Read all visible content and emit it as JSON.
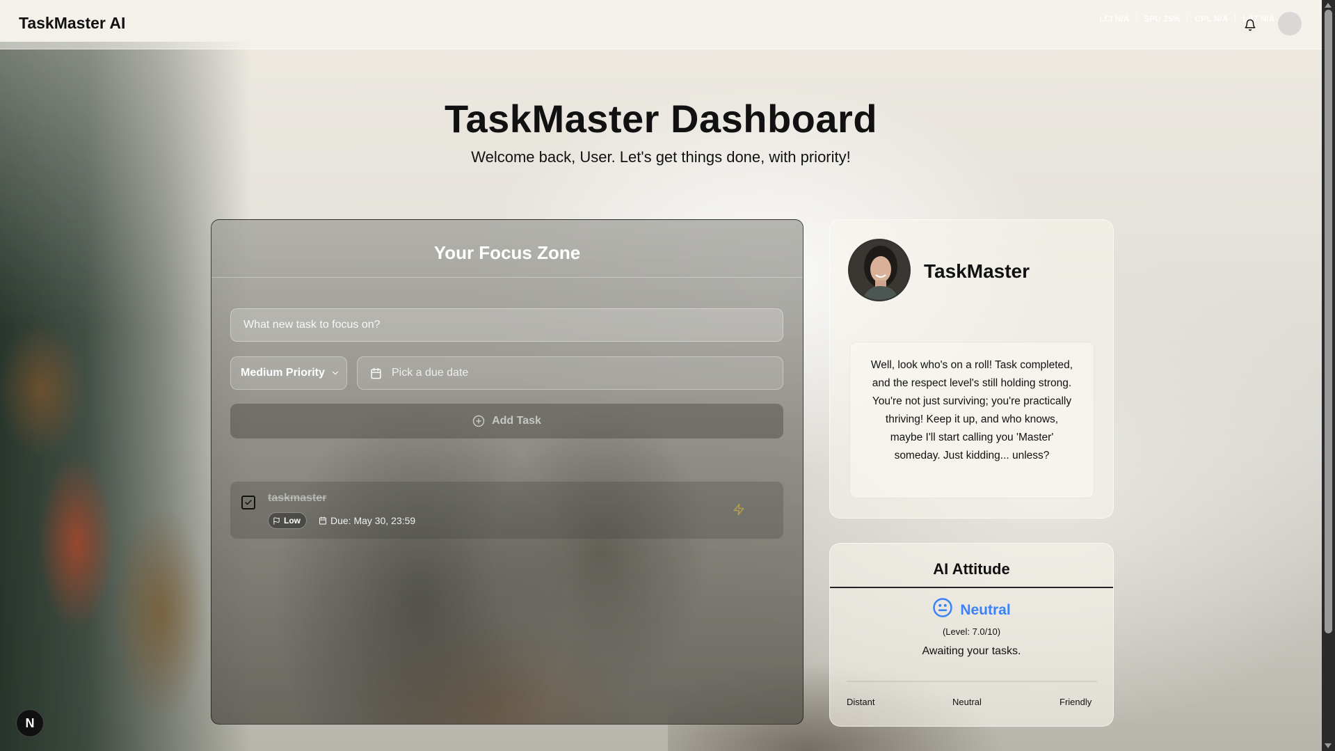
{
  "app": {
    "name": "TaskMaster AI"
  },
  "header": {
    "stats": [
      {
        "label": "LCI",
        "value": "N/A"
      },
      {
        "label": "SPU",
        "value": "25%"
      },
      {
        "label": "CPL",
        "value": "N/A"
      },
      {
        "label": "LAT",
        "value": "N/A"
      }
    ],
    "notifications_icon": "bell-icon"
  },
  "hero": {
    "title": "TaskMaster Dashboard",
    "subtitle": "Welcome back, User. Let's get things done, with priority!"
  },
  "focus": {
    "title": "Your Focus Zone",
    "input_placeholder": "What new task to focus on?",
    "priority_selected": "Medium Priority",
    "date_placeholder": "Pick a due date",
    "add_button": "Add Task",
    "tasks": [
      {
        "name": "taskmaster",
        "priority": "Low",
        "due": "Due: May 30, 23:59",
        "completed": true
      }
    ]
  },
  "profile": {
    "name": "TaskMaster",
    "message": "Well, look who's on a roll! Task completed, and the respect level's still holding strong. You're not just surviving; you're practically thriving! Keep it up, and who knows, maybe I'll start calling you 'Master' someday. Just kidding... unless?"
  },
  "attitude": {
    "title": "AI Attitude",
    "mood": "Neutral",
    "level": "(Level: 7.0/10)",
    "status": "Awaiting your tasks.",
    "scale": [
      "Distant",
      "Neutral",
      "Friendly"
    ],
    "accent": "#3b82f6"
  },
  "badge": {
    "letter": "N"
  }
}
